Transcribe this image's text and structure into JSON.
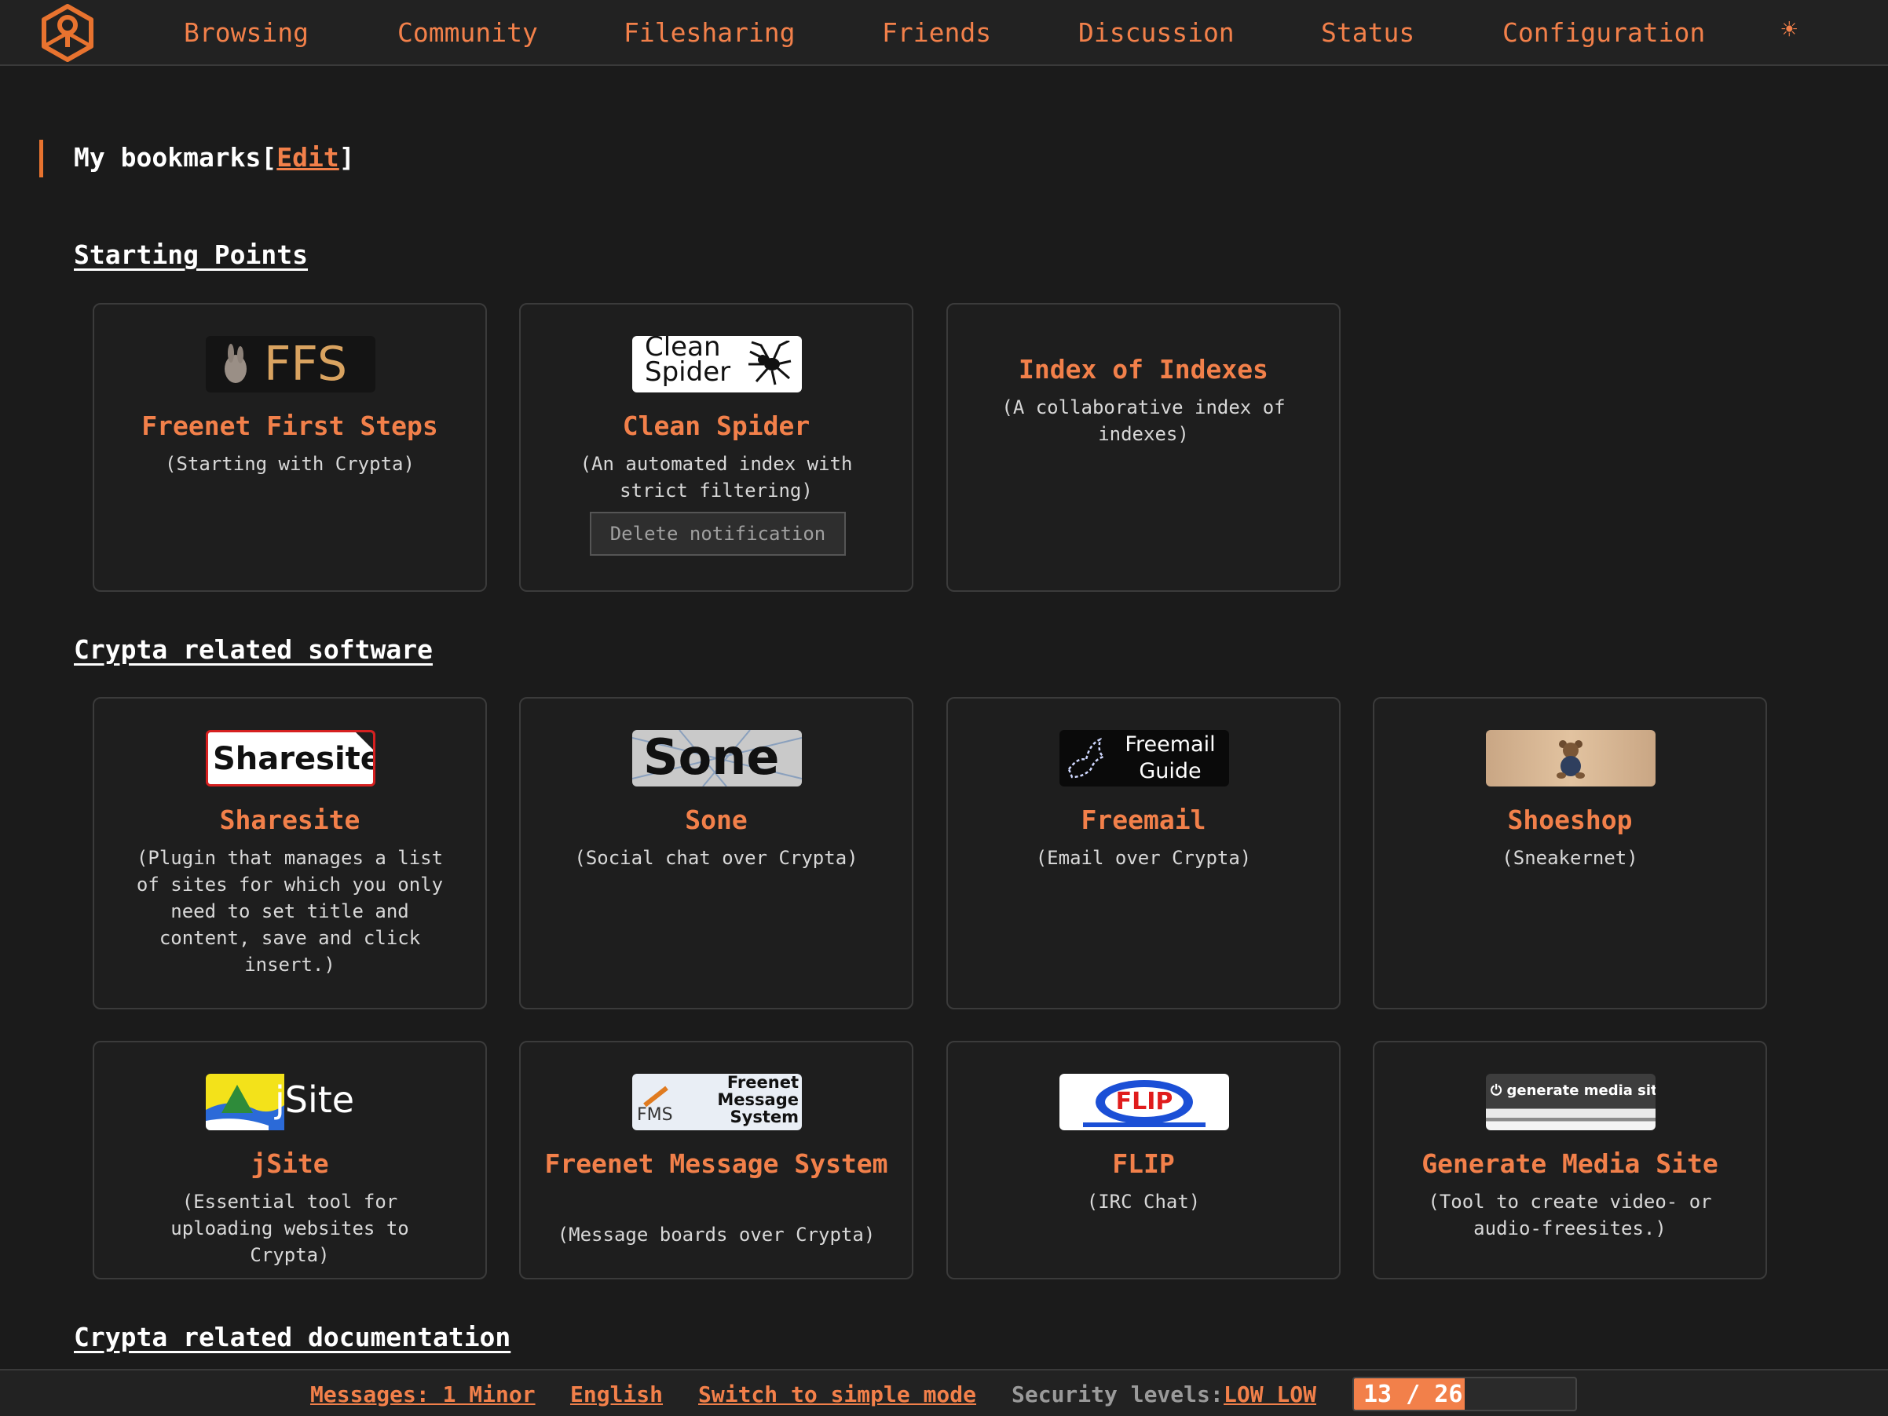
{
  "nav": {
    "items": [
      "Browsing",
      "Community",
      "Filesharing",
      "Friends",
      "Discussion",
      "Status",
      "Configuration"
    ],
    "theme_icon": "sun-icon",
    "logo_icon": "hexagon-logo-icon",
    "accent_color": "#f2804a"
  },
  "bookmarks": {
    "title": "My bookmarks",
    "bracket_open": "[",
    "edit_label": "Edit",
    "bracket_close": "]"
  },
  "sections": [
    {
      "title": "Starting Points",
      "cards": [
        {
          "image_text": "FFS",
          "title": "Freenet First Steps",
          "desc": "(Starting with Crypta)"
        },
        {
          "image_text": "Clean Spider",
          "title": "Clean Spider",
          "desc": "(An automated index with strict filtering)",
          "button": "Delete notification"
        },
        {
          "title": "Index of Indexes",
          "desc": "(A collaborative index of indexes)"
        }
      ]
    },
    {
      "title": "Crypta related software",
      "cards": [
        {
          "image_text": "Sharesite",
          "title": "Sharesite",
          "desc": "(Plugin that manages a list of sites for which you only need to set title and content, save and click insert.)"
        },
        {
          "image_text": "Sone",
          "title": "Sone",
          "desc": "(Social chat over Crypta)"
        },
        {
          "image_text": "Freemail Guide",
          "title": "Freemail",
          "desc": "(Email over Crypta)"
        },
        {
          "title": "Shoeshop",
          "desc": "(Sneakernet)"
        },
        {
          "image_text": "jSite",
          "title": "jSite",
          "desc": "(Essential tool for uploading websites to Crypta)"
        },
        {
          "image_text": "Freenet Message System",
          "image_small": "FMS",
          "title": "Freenet Message System",
          "desc": "(Message boards over Crypta)"
        },
        {
          "image_text": "FLIP",
          "title": "FLIP",
          "desc": "(IRC Chat)"
        },
        {
          "image_text": "generate media site",
          "title": "Generate Media Site",
          "desc": "(Tool to create video- or audio-freesites.)"
        }
      ]
    },
    {
      "title": "Crypta related documentation"
    }
  ],
  "footer": {
    "messages": "Messages: 1 Minor",
    "language": "English",
    "mode": "Switch to simple mode",
    "security_label": "Security levels:",
    "security_levels": "LOW LOW",
    "progress_label": "13 / 26",
    "progress_fraction": 0.5
  }
}
